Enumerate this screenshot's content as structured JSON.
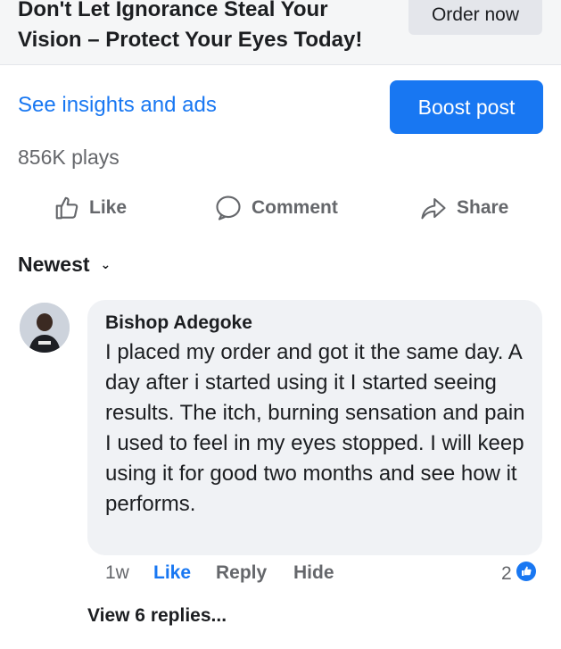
{
  "ad": {
    "headline": "Don't Let Ignorance Steal Your Vision – Protect Your Eyes Today!",
    "cta_label": "Order now"
  },
  "post": {
    "insights_label": "See insights and ads",
    "boost_label": "Boost post",
    "plays": "856K plays"
  },
  "actions": {
    "like": "Like",
    "comment": "Comment",
    "share": "Share"
  },
  "sort": {
    "label": "Newest",
    "chevron": "⌄"
  },
  "comment": {
    "author": "Bishop Adegoke",
    "text": "I placed my order and got it the same day. A day after i started using it I started seeing results. The itch, burning sensation and pain I used to feel in my eyes stopped. I will keep using it for good two months and see how  it performs.",
    "time": "1w",
    "like": "Like",
    "reply": "Reply",
    "hide": "Hide",
    "reaction_count": "2",
    "view_replies": "View 6 replies..."
  },
  "colors": {
    "accent": "#1877f2",
    "muted": "#65676b",
    "bubble": "#f0f2f5"
  },
  "icons": {
    "like": "thumbs-up-icon",
    "comment": "speech-bubble-icon",
    "share": "share-arrow-icon",
    "reaction": "like-reaction-icon"
  }
}
